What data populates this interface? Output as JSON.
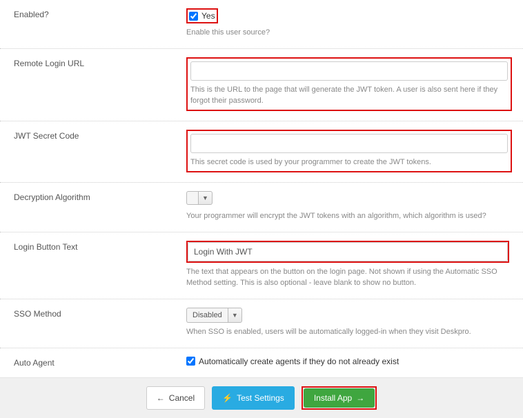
{
  "fields": {
    "enabled": {
      "label": "Enabled?",
      "checkbox_text": "Yes",
      "help": "Enable this user source?"
    },
    "remote_url": {
      "label": "Remote Login URL",
      "value": "",
      "help": "This is the URL to the page that will generate the JWT token. A user is also sent here if they forgot their password."
    },
    "secret": {
      "label": "JWT Secret Code",
      "value": "",
      "help": "This secret code is used by your programmer to create the JWT tokens."
    },
    "algorithm": {
      "label": "Decryption Algorithm",
      "selected": "",
      "help": "Your programmer will encrypt the JWT tokens with an algorithm, which algorithm is used?"
    },
    "button_text": {
      "label": "Login Button Text",
      "value": "Login With JWT",
      "help": "The text that appears on the button on the login page. Not shown if using the Automatic SSO Method setting. This is also optional - leave blank to show no button."
    },
    "sso": {
      "label": "SSO Method",
      "selected": "Disabled",
      "help": "When SSO is enabled, users will be automatically logged-in when they visit Deskpro."
    },
    "auto_agent": {
      "label": "Auto Agent",
      "checkbox_text": "Automatically create agents if they do not already exist"
    }
  },
  "buttons": {
    "cancel": "Cancel",
    "test": "Test Settings",
    "install": "Install App"
  }
}
